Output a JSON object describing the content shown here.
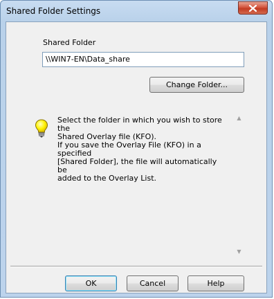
{
  "window": {
    "title": "Shared Folder Settings",
    "close_icon": "close-x-icon"
  },
  "shared_folder": {
    "label": "Shared Folder",
    "value": "\\\\WIN7-EN\\Data_share",
    "change_button_label": "Change Folder..."
  },
  "info": {
    "icon": "lightbulb-icon",
    "text": "Select the folder in which you wish to store the\nShared Overlay file (KFO).\nIf you save the Overlay File (KFO) in a specified\n[Shared Folder], the file will automatically be\nadded to the Overlay List."
  },
  "buttons": {
    "ok": "OK",
    "cancel": "Cancel",
    "help": "Help"
  },
  "colors": {
    "title_bar": "#b9d1ea",
    "close_button": "#c23b22",
    "dialog_face": "#f0f0f0",
    "bulb": "#fff200"
  }
}
